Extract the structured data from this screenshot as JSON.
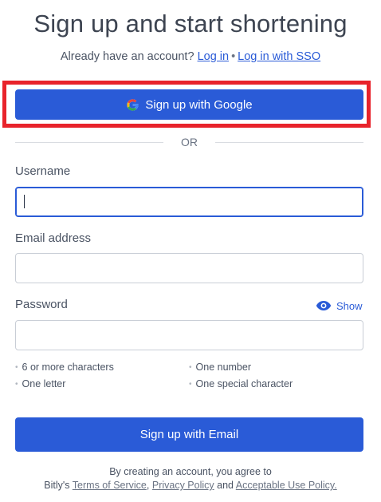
{
  "header": {
    "title": "Sign up and start shortening",
    "account_prompt": "Already have an account?",
    "login_link": "Log in",
    "separator": "•",
    "sso_link": "Log in with SSO"
  },
  "google_button": {
    "label": "Sign up with Google"
  },
  "divider": {
    "text": "OR"
  },
  "form": {
    "username_label": "Username",
    "username_value": "",
    "email_label": "Email address",
    "email_value": "",
    "password_label": "Password",
    "password_value": "",
    "show_toggle": "Show"
  },
  "password_requirements": [
    "6 or more characters",
    "One number",
    "One letter",
    "One special character"
  ],
  "email_button": {
    "label": "Sign up with Email"
  },
  "terms": {
    "line1": "By creating an account, you agree to",
    "prefix": "Bitly's",
    "tos": "Terms of Service",
    "comma": ",",
    "privacy": "Privacy Policy",
    "and": "and",
    "aup": "Acceptable Use Policy."
  },
  "colors": {
    "primary": "#2a5bd7",
    "highlight_border": "#e8232b",
    "text": "#4a5363"
  },
  "icons": {
    "google": "google-g-icon",
    "eye": "eye-icon"
  }
}
